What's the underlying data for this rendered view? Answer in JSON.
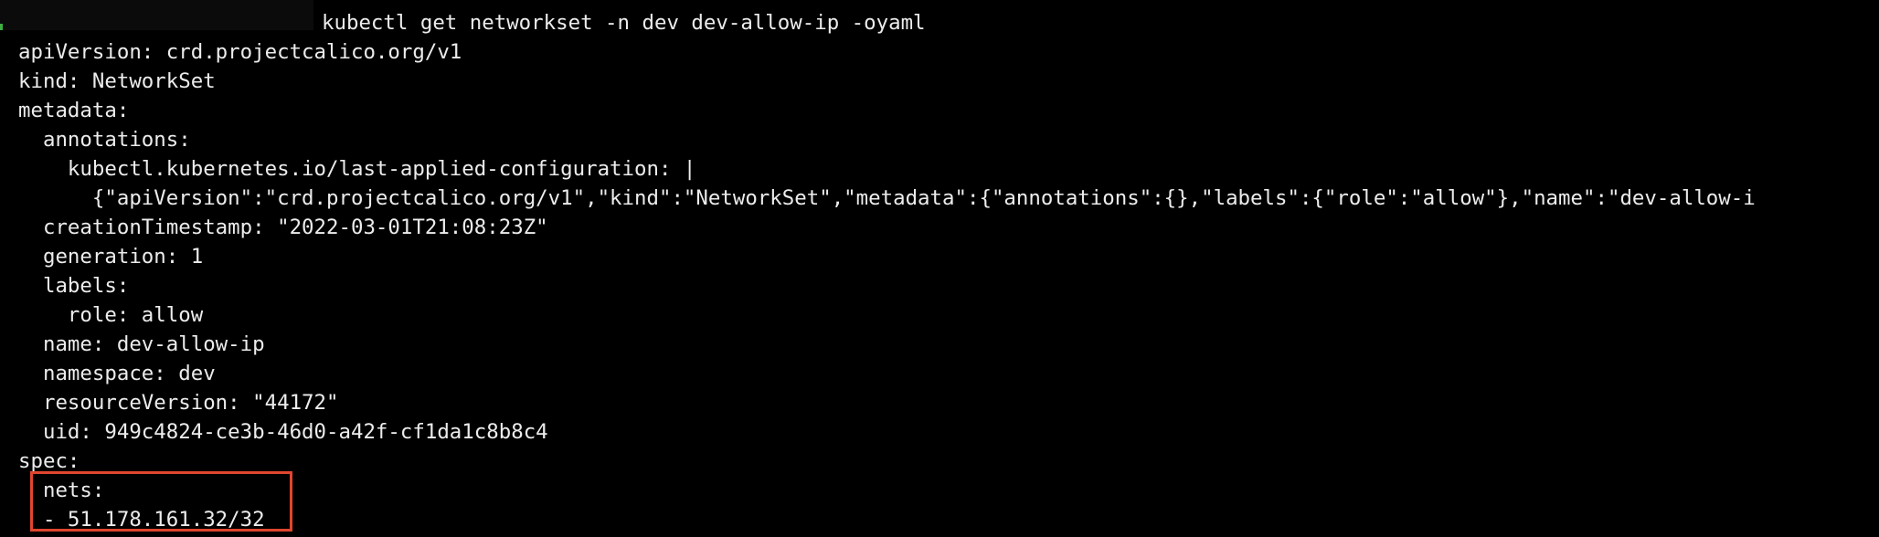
{
  "command": "kubectl get networkset -n dev dev-allow-ip -oyaml",
  "output_lines": [
    "apiVersion: crd.projectcalico.org/v1",
    "kind: NetworkSet",
    "metadata:",
    "  annotations:",
    "    kubectl.kubernetes.io/last-applied-configuration: |",
    "      {\"apiVersion\":\"crd.projectcalico.org/v1\",\"kind\":\"NetworkSet\",\"metadata\":{\"annotations\":{},\"labels\":{\"role\":\"allow\"},\"name\":\"dev-allow-i",
    "  creationTimestamp: \"2022-03-01T21:08:23Z\"",
    "  generation: 1",
    "  labels:",
    "    role: allow",
    "  name: dev-allow-ip",
    "  namespace: dev",
    "  resourceVersion: \"44172\"",
    "  uid: 949c4824-ce3b-46d0-a42f-cf1da1c8b8c4",
    "spec:",
    "  nets:",
    "  - 51.178.161.32/32"
  ],
  "colors": {
    "background": "#000000",
    "text": "#ececec",
    "highlight": "#e0462f"
  }
}
